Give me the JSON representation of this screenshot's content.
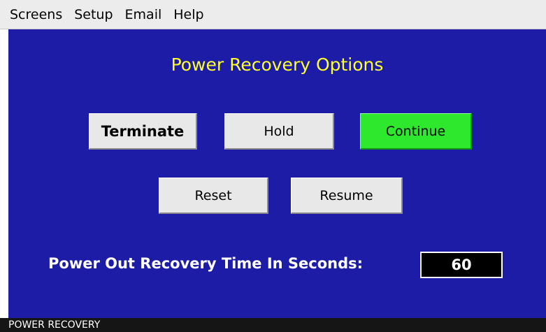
{
  "menubar": {
    "items": [
      {
        "label": "Screens"
      },
      {
        "label": "Setup"
      },
      {
        "label": "Email"
      },
      {
        "label": "Help"
      }
    ]
  },
  "panel": {
    "title": "Power Recovery Options",
    "buttons": {
      "terminate": "Terminate",
      "hold": "Hold",
      "continue": "Continue",
      "reset": "Reset",
      "resume": "Resume"
    },
    "recovery_time": {
      "label": "Power Out Recovery Time In Seconds:",
      "value": "60"
    }
  },
  "status": {
    "text": "POWER RECOVERY"
  },
  "colors": {
    "panel_background": "#1c1ca6",
    "title_text": "#ffff2e",
    "continue_button": "#2ee82e",
    "button_background": "#e8e8e8",
    "status_bar": "#151515"
  }
}
